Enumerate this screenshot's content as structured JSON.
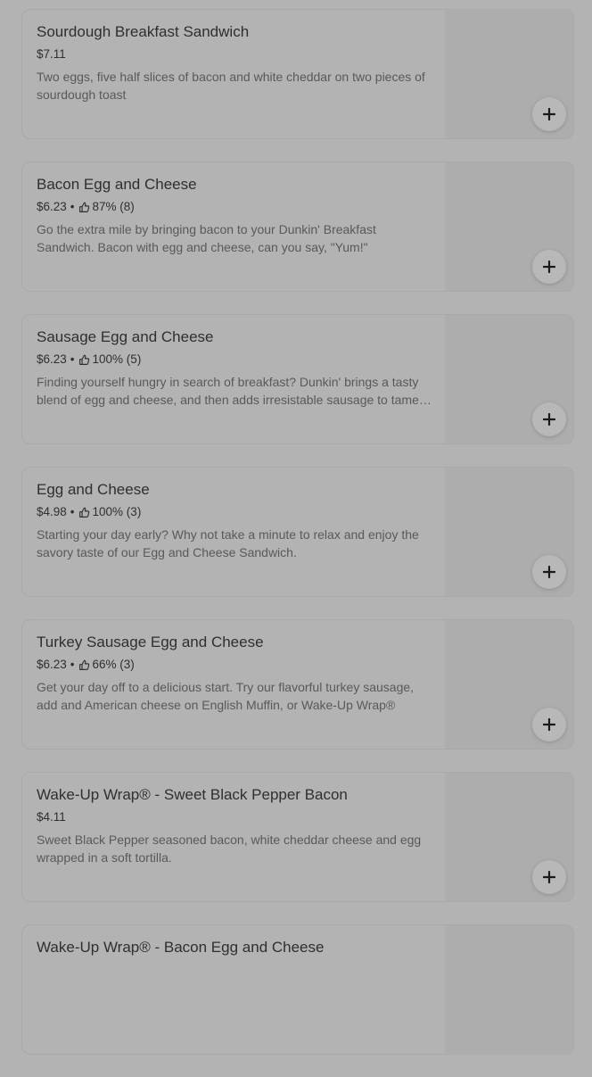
{
  "menu_items": [
    {
      "title": "Sourdough Breakfast Sandwich",
      "price": "$7.11",
      "rating": "",
      "description": "Two eggs, five half slices of bacon and white cheddar on two pieces of sourdough toast"
    },
    {
      "title": "Bacon Egg and Cheese",
      "price": "$6.23",
      "rating": "87% (8)",
      "description": "Go the extra mile by bringing bacon to your Dunkin' Breakfast Sandwich. Bacon with egg and cheese, can you say, \"Yum!\""
    },
    {
      "title": "Sausage Egg and Cheese",
      "price": "$6.23",
      "rating": "100% (5)",
      "description": "Finding yourself hungry in search of breakfast? Dunkin' brings a tasty blend of egg and cheese, and then adds irresistable sausage to tame your appetite."
    },
    {
      "title": "Egg and Cheese",
      "price": "$4.98",
      "rating": "100% (3)",
      "description": "Starting your day early? Why not take a minute to relax and enjoy the savory taste of our Egg and Cheese Sandwich."
    },
    {
      "title": "Turkey Sausage Egg and Cheese",
      "price": "$6.23",
      "rating": "66% (3)",
      "description": "Get your day off to a delicious start. Try our flavorful turkey sausage, add and American cheese on English Muffin, or Wake-Up Wrap®"
    },
    {
      "title": "Wake-Up Wrap® - Sweet Black Pepper Bacon",
      "price": "$4.11",
      "rating": "",
      "description": "Sweet Black Pepper seasoned bacon, white cheddar cheese and egg wrapped in a soft tortilla."
    },
    {
      "title": "Wake-Up Wrap® - Bacon Egg and Cheese",
      "price": "",
      "rating": "",
      "description": ""
    }
  ],
  "separator": "•",
  "icons": {
    "rating": "thumbs-up-icon",
    "add": "plus-icon"
  },
  "colors": {
    "overlay_background": "#b3b3b3",
    "title_text": "#2f2f2f",
    "description_text": "#595959"
  }
}
